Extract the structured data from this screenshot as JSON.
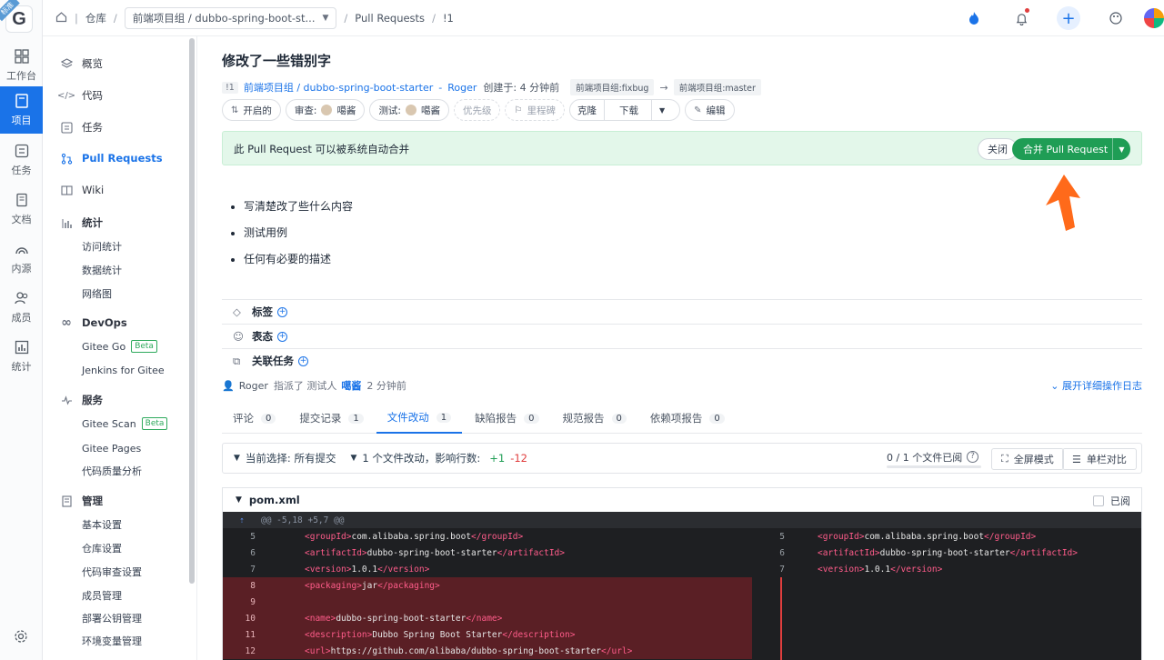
{
  "rail": {
    "logo_letter": "G",
    "logo_badge": "标准",
    "items": [
      {
        "label": "工作台",
        "icon": "grid-icon"
      },
      {
        "label": "项目",
        "icon": "book-icon",
        "active": true
      },
      {
        "label": "任务",
        "icon": "checklist-icon"
      },
      {
        "label": "文档",
        "icon": "document-icon"
      },
      {
        "label": "内源",
        "icon": "rainbow-icon"
      },
      {
        "label": "成员",
        "icon": "users-icon"
      },
      {
        "label": "统计",
        "icon": "bar-chart-icon"
      }
    ]
  },
  "breadcrumb": {
    "home_icon": "home-icon",
    "repo_root": "仓库",
    "repo_select": "前端项目组 / dubbo-spring-boot-st...",
    "section": "Pull Requests",
    "current": "!1"
  },
  "sidebar": {
    "overview": "概览",
    "code": "代码",
    "tasks": "任务",
    "pull_requests": "Pull Requests",
    "wiki": "Wiki",
    "stats": "统计",
    "stats_items": [
      "访问统计",
      "数据统计",
      "网络图"
    ],
    "devops": "DevOps",
    "devops_items": [
      {
        "label": "Gitee Go",
        "beta": "Beta"
      },
      {
        "label": "Jenkins for Gitee"
      }
    ],
    "services": "服务",
    "services_items": [
      {
        "label": "Gitee Scan",
        "beta": "Beta"
      },
      {
        "label": "Gitee Pages"
      },
      {
        "label": "代码质量分析"
      }
    ],
    "manage": "管理",
    "manage_items": [
      "基本设置",
      "仓库设置",
      "代码审查设置",
      "成员管理",
      "部署公钥管理",
      "环境变量管理"
    ]
  },
  "pr": {
    "title": "修改了一些错别字",
    "id": "!1",
    "repo_link": "前端项目组 / dubbo-spring-boot-starter",
    "dash": "-",
    "author": "Roger",
    "created": "创建于: 4 分钟前",
    "source_branch": "前端项目组:fixbug",
    "arrow": "→",
    "target_branch": "前端项目组:master",
    "tags": {
      "status": "开启的",
      "review_label": "审查:",
      "reviewer": "噶酱",
      "test_label": "测试:",
      "tester": "噶酱",
      "priority": "优先级",
      "milestone": "里程碑",
      "clone": "克隆",
      "download": "下载",
      "edit": "编辑"
    },
    "merge_msg": "此 Pull Request 可以被系统自动合并",
    "close_btn": "关闭",
    "merge_btn": "合并 Pull Request",
    "description": [
      "写清楚改了些什么内容",
      "测试用例",
      "任何有必要的描述"
    ],
    "meta_rows": [
      "标签",
      "表态",
      "关联任务"
    ],
    "activity": {
      "user": "Roger",
      "action": "指派了 测试人",
      "target": "噶酱",
      "time": "2 分钟前",
      "expand": "展开详细操作日志"
    }
  },
  "tabs": [
    {
      "label": "评论",
      "count": "0"
    },
    {
      "label": "提交记录",
      "count": "1"
    },
    {
      "label": "文件改动",
      "count": "1",
      "active": true
    },
    {
      "label": "缺陷报告",
      "count": "0"
    },
    {
      "label": "规范报告",
      "count": "0"
    },
    {
      "label": "依赖项报告",
      "count": "0"
    }
  ],
  "filebar": {
    "commit_select": "当前选择: 所有提交",
    "summary": "1 个文件改动，影响行数:",
    "additions": "+1",
    "deletions": "-12",
    "viewed": "0 / 1 个文件已阅",
    "viewed_fraction": 0,
    "fullscreen": "全屏模式",
    "single_column": "单栏对比"
  },
  "diff": {
    "filename": "pom.xml",
    "viewed_label": "已阅",
    "hunk": "@@ -5,18 +5,7 @@",
    "left_lines": [
      {
        "n": "5",
        "pre": "<groupId>",
        "txt": "com.alibaba.spring.boot",
        "post": "</groupId>"
      },
      {
        "n": "6",
        "pre": "<artifactId>",
        "txt": "dubbo-spring-boot-starter",
        "post": "</artifactId>"
      },
      {
        "n": "7",
        "pre": "<version>",
        "txt": "1.0.1",
        "post": "</version>"
      },
      {
        "n": "8",
        "pre": "<packaging>",
        "txt": "jar",
        "post": "</packaging>",
        "del": true
      },
      {
        "n": "9",
        "pre": "",
        "txt": "",
        "post": "",
        "del": true
      },
      {
        "n": "10",
        "pre": "<name>",
        "txt": "dubbo-spring-boot-starter",
        "post": "</name>",
        "del": true
      },
      {
        "n": "11",
        "pre": "<description>",
        "txt": "Dubbo Spring Boot Starter",
        "post": "</description>",
        "del": true
      },
      {
        "n": "12",
        "pre": "<url>",
        "txt": "https://github.com/alibaba/dubbo-spring-boot-starter",
        "post": "</url>",
        "del": true
      }
    ],
    "right_lines": [
      {
        "n": "5",
        "pre": "<groupId>",
        "txt": "com.alibaba.spring.boot",
        "post": "</groupId>"
      },
      {
        "n": "6",
        "pre": "<artifactId>",
        "txt": "dubbo-spring-boot-starter",
        "post": "</artifactId>"
      },
      {
        "n": "7",
        "pre": "<version>",
        "txt": "1.0.1",
        "post": "</version>"
      }
    ]
  },
  "colors": {
    "primary": "#1a73e8",
    "merge_green": "#1f9d55",
    "merge_bar_bg": "#e3f7ea",
    "callout_arrow": "#ff6a1a",
    "deleted_bg": "#5a1f25"
  }
}
